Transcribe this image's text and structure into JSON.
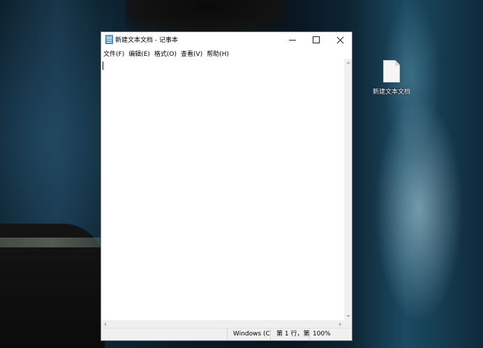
{
  "window": {
    "title": "新建文本文档 - 记事本",
    "app_icon": "notepad-icon",
    "controls": {
      "minimize": "minimize-icon",
      "maximize": "maximize-icon",
      "close": "close-icon"
    }
  },
  "menu": {
    "items": [
      {
        "label": "文件(F)"
      },
      {
        "label": "编辑(E)"
      },
      {
        "label": "格式(O)"
      },
      {
        "label": "查看(V)"
      },
      {
        "label": "帮助(H)"
      }
    ]
  },
  "editor": {
    "content": ""
  },
  "statusbar": {
    "encoding": "Windows (C",
    "position": "第 1 行，第",
    "zoom": "100%"
  },
  "desktop": {
    "icons": [
      {
        "label": "新建文本文档",
        "icon": "text-file-icon"
      }
    ]
  }
}
